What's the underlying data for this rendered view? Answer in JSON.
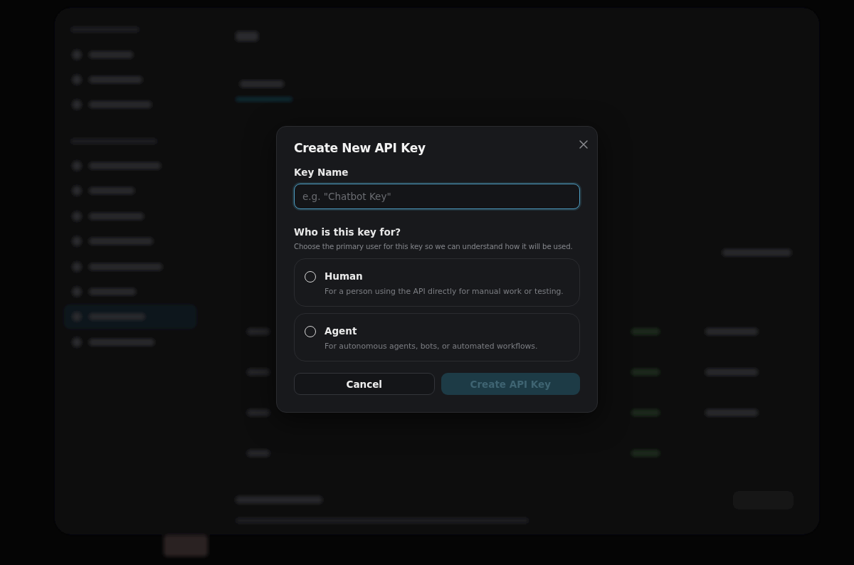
{
  "dialog": {
    "title": "Create New API Key",
    "key_name": {
      "label": "Key Name",
      "placeholder": "e.g. \"Chatbot Key\"",
      "focused": true
    },
    "audience": {
      "question": "Who is this key for?",
      "hint": "Choose the primary user for this key so we can understand how it will be used.",
      "options": [
        {
          "label": "Human",
          "description": "For a person using the API directly for manual work or testing.",
          "selected": false
        },
        {
          "label": "Agent",
          "description": "For autonomous agents, bots, or automated workflows.",
          "selected": false
        }
      ]
    },
    "buttons": [
      {
        "kind": "secondary",
        "label": "Cancel",
        "disabled": false
      },
      {
        "kind": "primary",
        "label": "Create API Key",
        "disabled": true
      }
    ]
  }
}
